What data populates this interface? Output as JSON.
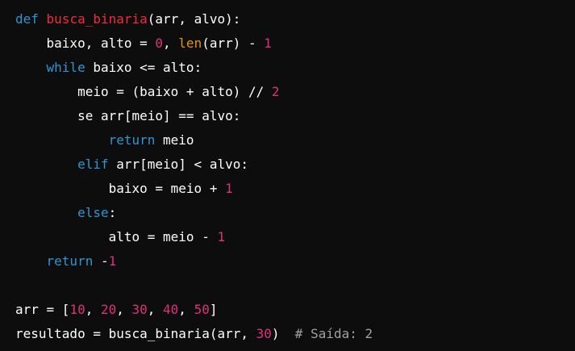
{
  "code": {
    "language": "python",
    "lines": [
      [
        {
          "text": "def",
          "type": "kw"
        },
        {
          "text": " ",
          "type": "plain"
        },
        {
          "text": "busca_binaria",
          "type": "fn"
        },
        {
          "text": "(arr, alvo):",
          "type": "plain"
        }
      ],
      [
        {
          "text": "    baixo, alto = ",
          "type": "plain"
        },
        {
          "text": "0",
          "type": "num"
        },
        {
          "text": ", ",
          "type": "plain"
        },
        {
          "text": "len",
          "type": "builtin"
        },
        {
          "text": "(arr) - ",
          "type": "plain"
        },
        {
          "text": "1",
          "type": "num"
        }
      ],
      [
        {
          "text": "    ",
          "type": "plain"
        },
        {
          "text": "while",
          "type": "kw"
        },
        {
          "text": " baixo <= alto:",
          "type": "plain"
        }
      ],
      [
        {
          "text": "        meio = (baixo + alto) // ",
          "type": "plain"
        },
        {
          "text": "2",
          "type": "num"
        }
      ],
      [
        {
          "text": "        se arr[meio] == alvo:",
          "type": "plain"
        }
      ],
      [
        {
          "text": "            ",
          "type": "plain"
        },
        {
          "text": "return",
          "type": "kw"
        },
        {
          "text": " meio",
          "type": "plain"
        }
      ],
      [
        {
          "text": "        ",
          "type": "plain"
        },
        {
          "text": "elif",
          "type": "kw"
        },
        {
          "text": " arr[meio] < alvo:",
          "type": "plain"
        }
      ],
      [
        {
          "text": "            baixo = meio + ",
          "type": "plain"
        },
        {
          "text": "1",
          "type": "num"
        }
      ],
      [
        {
          "text": "        ",
          "type": "plain"
        },
        {
          "text": "else",
          "type": "kw"
        },
        {
          "text": ":",
          "type": "plain"
        }
      ],
      [
        {
          "text": "            alto = meio - ",
          "type": "plain"
        },
        {
          "text": "1",
          "type": "num"
        }
      ],
      [
        {
          "text": "    ",
          "type": "plain"
        },
        {
          "text": "return",
          "type": "kw"
        },
        {
          "text": " -",
          "type": "plain"
        },
        {
          "text": "1",
          "type": "num"
        }
      ],
      [],
      [
        {
          "text": "arr = [",
          "type": "plain"
        },
        {
          "text": "10",
          "type": "num"
        },
        {
          "text": ", ",
          "type": "plain"
        },
        {
          "text": "20",
          "type": "num"
        },
        {
          "text": ", ",
          "type": "plain"
        },
        {
          "text": "30",
          "type": "num"
        },
        {
          "text": ", ",
          "type": "plain"
        },
        {
          "text": "40",
          "type": "num"
        },
        {
          "text": ", ",
          "type": "plain"
        },
        {
          "text": "50",
          "type": "num"
        },
        {
          "text": "]",
          "type": "plain"
        }
      ],
      [
        {
          "text": "resultado = busca_binaria(arr, ",
          "type": "plain"
        },
        {
          "text": "30",
          "type": "num"
        },
        {
          "text": ")  ",
          "type": "plain"
        },
        {
          "text": "# Saída: 2",
          "type": "comment"
        }
      ]
    ]
  },
  "colors": {
    "background": "#0d0d0d",
    "keyword": "#2e95d3",
    "function_name": "#f22c3d",
    "number": "#df3079",
    "builtin": "#e9950c",
    "comment": "#a1a1a1",
    "plain": "#ffffff"
  }
}
